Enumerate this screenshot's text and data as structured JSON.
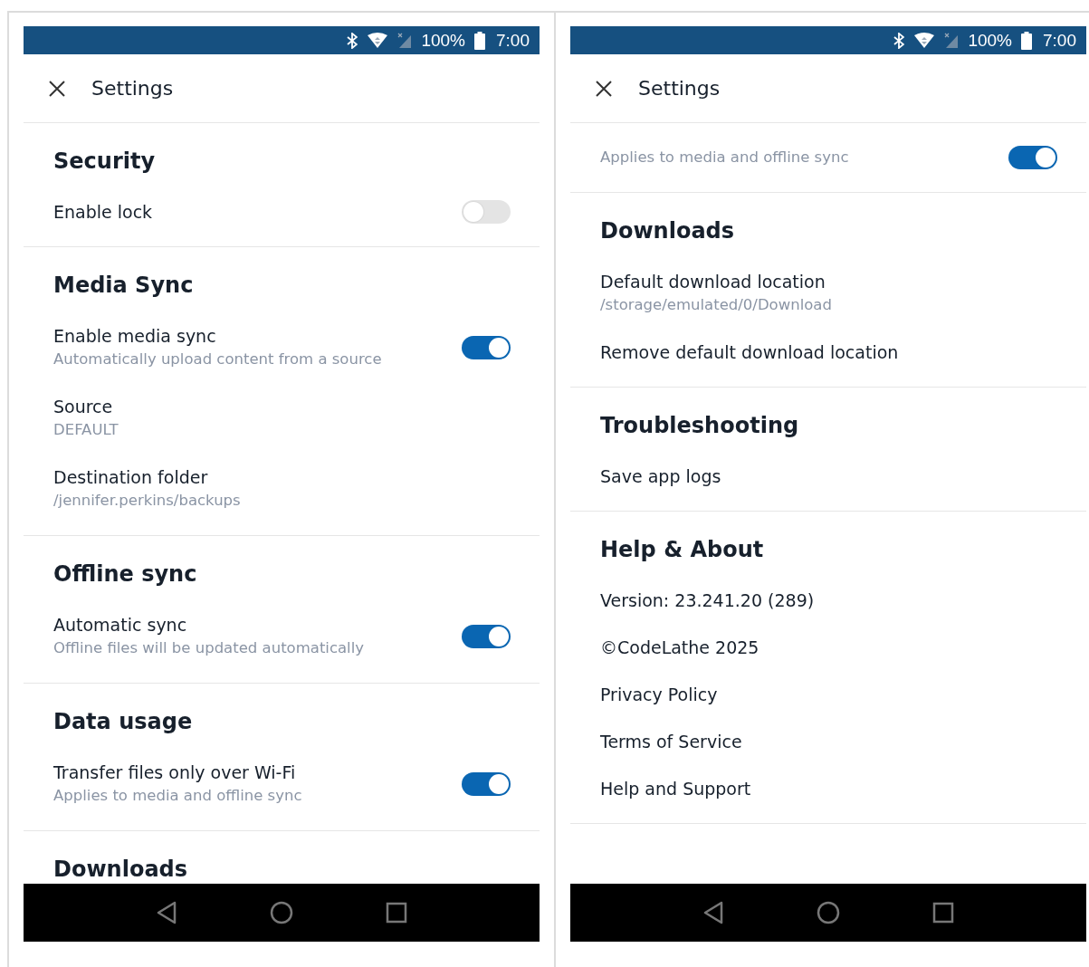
{
  "screens": [
    {
      "status_bar": {
        "battery": "100%",
        "time": "7:00"
      },
      "header": {
        "title": "Settings"
      },
      "scrolled": false,
      "sections": [
        {
          "title": "Security",
          "items": [
            {
              "kind": "toggle",
              "label": "Enable lock",
              "on": false
            }
          ]
        },
        {
          "title": "Media Sync",
          "items": [
            {
              "kind": "toggle",
              "label": "Enable media sync",
              "sublabel": "Automatically upload content from a source",
              "on": true
            },
            {
              "kind": "detail",
              "label": "Source",
              "sublabel": "DEFAULT"
            },
            {
              "kind": "detail",
              "label": "Destination folder",
              "sublabel": "/jennifer.perkins/backups"
            }
          ]
        },
        {
          "title": "Offline sync",
          "items": [
            {
              "kind": "toggle",
              "label": "Automatic sync",
              "sublabel": "Offline files will be updated automatically",
              "on": true
            }
          ]
        },
        {
          "title": "Data usage",
          "items": [
            {
              "kind": "toggle",
              "label": "Transfer files only over Wi-Fi",
              "sublabel": "Applies to media and offline sync",
              "on": true
            }
          ]
        },
        {
          "title": "Downloads"
        }
      ]
    },
    {
      "status_bar": {
        "battery": "100%",
        "time": "7:00"
      },
      "header": {
        "title": "Settings"
      },
      "scrolled": true,
      "sections": [
        {
          "items": [
            {
              "kind": "toggle",
              "sublabel": "Applies to media and offline sync",
              "on": true
            }
          ]
        },
        {
          "title": "Downloads",
          "items": [
            {
              "kind": "detail",
              "label": "Default download location",
              "sublabel": "/storage/emulated/0/Download"
            },
            {
              "kind": "detail",
              "label": "Remove default download location"
            }
          ]
        },
        {
          "title": "Troubleshooting",
          "items": [
            {
              "kind": "detail",
              "label": "Save app logs"
            }
          ]
        },
        {
          "title": "Help & About",
          "items": [
            {
              "kind": "info",
              "label": "Version: 23.241.20 (289)"
            },
            {
              "kind": "info",
              "label": "©CodeLathe 2025"
            },
            {
              "kind": "link",
              "label": "Privacy Policy"
            },
            {
              "kind": "link",
              "label": "Terms of Service"
            },
            {
              "kind": "link",
              "label": "Help and Support"
            }
          ]
        }
      ]
    }
  ]
}
